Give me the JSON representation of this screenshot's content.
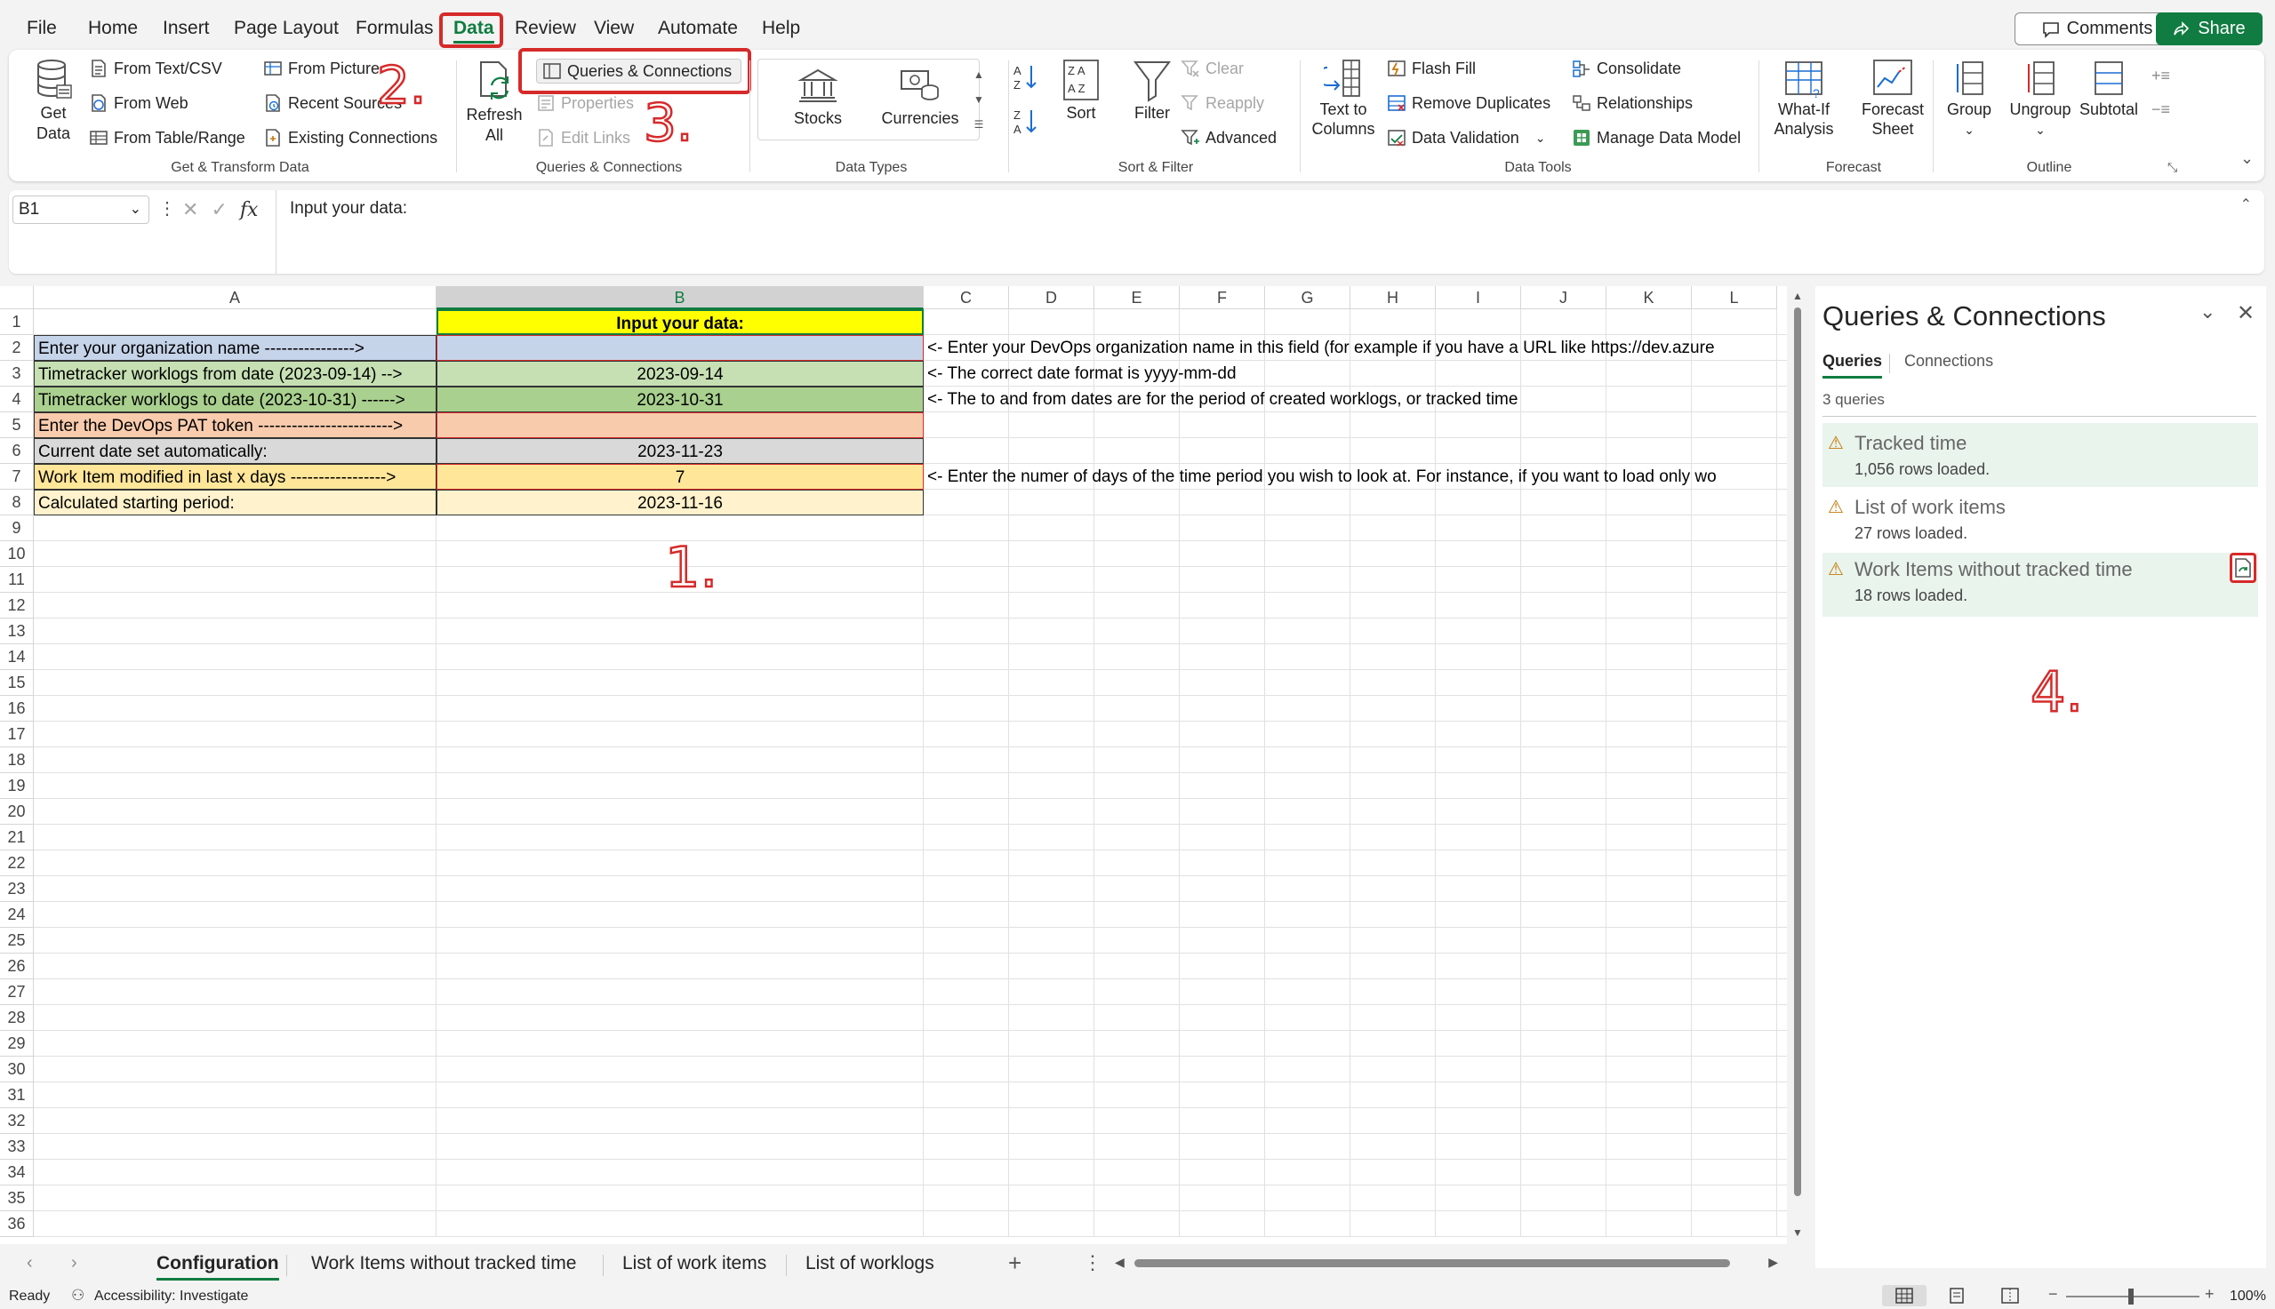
{
  "menu": {
    "items": [
      "File",
      "Home",
      "Insert",
      "Page Layout",
      "Formulas",
      "Data",
      "Review",
      "View",
      "Automate",
      "Help"
    ],
    "active": "Data",
    "comments": "Comments",
    "share": "Share"
  },
  "ribbon": {
    "get_transform": {
      "get_data": "Get Data",
      "from_text_csv": "From Text/CSV",
      "from_web": "From Web",
      "from_table_range": "From Table/Range",
      "from_picture": "From Picture",
      "recent_sources": "Recent Sources",
      "existing_connections": "Existing Connections",
      "label": "Get & Transform Data"
    },
    "queries": {
      "refresh_all": "Refresh All",
      "queries_connections": "Queries & Connections",
      "properties": "Properties",
      "edit_links": "Edit Links",
      "label": "Queries & Connections"
    },
    "data_types": {
      "stocks": "Stocks",
      "currencies": "Currencies",
      "label": "Data Types"
    },
    "sort_filter": {
      "sort": "Sort",
      "filter": "Filter",
      "clear": "Clear",
      "reapply": "Reapply",
      "advanced": "Advanced",
      "label": "Sort & Filter"
    },
    "data_tools": {
      "text_to_columns": "Text to Columns",
      "flash_fill": "Flash Fill",
      "remove_duplicates": "Remove Duplicates",
      "data_validation": "Data Validation",
      "consolidate": "Consolidate",
      "relationships": "Relationships",
      "manage_data_model": "Manage Data Model",
      "label": "Data Tools"
    },
    "forecast": {
      "what_if": "What-If Analysis",
      "forecast_sheet": "Forecast Sheet",
      "label": "Forecast"
    },
    "outline": {
      "group": "Group",
      "ungroup": "Ungroup",
      "subtotal": "Subtotal",
      "label": "Outline"
    }
  },
  "formula_bar": {
    "name_box": "B1",
    "content": "Input your data:"
  },
  "annotations": {
    "one": "1.",
    "two": "2.",
    "three": "3.",
    "four": "4."
  },
  "grid": {
    "columns": [
      "A",
      "B",
      "C",
      "D",
      "E",
      "F",
      "G",
      "H",
      "I",
      "J",
      "K",
      "L"
    ],
    "selected_column": "B",
    "rows": [
      "1",
      "2",
      "3",
      "4",
      "5",
      "6",
      "7",
      "8",
      "9",
      "10",
      "11",
      "12",
      "13",
      "14",
      "15",
      "16",
      "17",
      "18",
      "19",
      "20",
      "21",
      "22",
      "23",
      "24",
      "25",
      "26",
      "27",
      "28",
      "29",
      "30",
      "31",
      "32",
      "33",
      "34",
      "35",
      "36"
    ],
    "cells": {
      "B1": "Input your data:",
      "A2": "Enter your organization name ---------------->",
      "C2": "<- Enter your DevOps organization name in this field (for example if you have a URL like https://dev.azure",
      "A3": "Timetracker worklogs from date (2023-09-14) -->",
      "B3": "2023-09-14",
      "C3": "<- The correct date format is yyyy-mm-dd",
      "A4": "Timetracker worklogs to date (2023-10-31) ------>",
      "B4": "2023-10-31",
      "C4": "<- The to and from dates are for the period of created worklogs, or tracked time",
      "A5": "Enter the DevOps PAT token ------------------------>",
      "A6": "Current date set automatically:",
      "B6": "2023-11-23",
      "A7": "Work Item modified in last x days ----------------->",
      "B7": "7",
      "C7": "<- Enter the numer of days of the time period you wish to look at. For instance, if you want to load only wo",
      "A8": "Calculated starting period:",
      "B8": "2023-11-16"
    },
    "fill_colors": {
      "yellow": "#ffff00",
      "blue": "#c6d4ea",
      "green": "#a9d08e",
      "green_light": "#c6e0b4",
      "orange": "#f8cbad",
      "gray": "#d9d9d9",
      "tan": "#ffe699",
      "tan_light": "#fff2cc"
    }
  },
  "pane": {
    "title": "Queries & Connections",
    "tabs": [
      "Queries",
      "Connections"
    ],
    "active_tab": "Queries",
    "count": "3 queries",
    "queries": [
      {
        "name": "Tracked time",
        "status": "1,056 rows loaded."
      },
      {
        "name": "List of work items",
        "status": "27 rows loaded."
      },
      {
        "name": "Work Items without tracked time",
        "status": "18 rows loaded."
      }
    ]
  },
  "sheet_tabs": {
    "tabs": [
      "Configuration",
      "Work Items without tracked time",
      "List of work items",
      "List of worklogs"
    ],
    "active": "Configuration"
  },
  "status_bar": {
    "ready": "Ready",
    "accessibility": "Accessibility: Investigate",
    "zoom": "100%"
  },
  "colors": {
    "excel_green": "#107c41",
    "annotation_red": "#d62a2a",
    "pane_highlight": "#e9f4ec"
  }
}
